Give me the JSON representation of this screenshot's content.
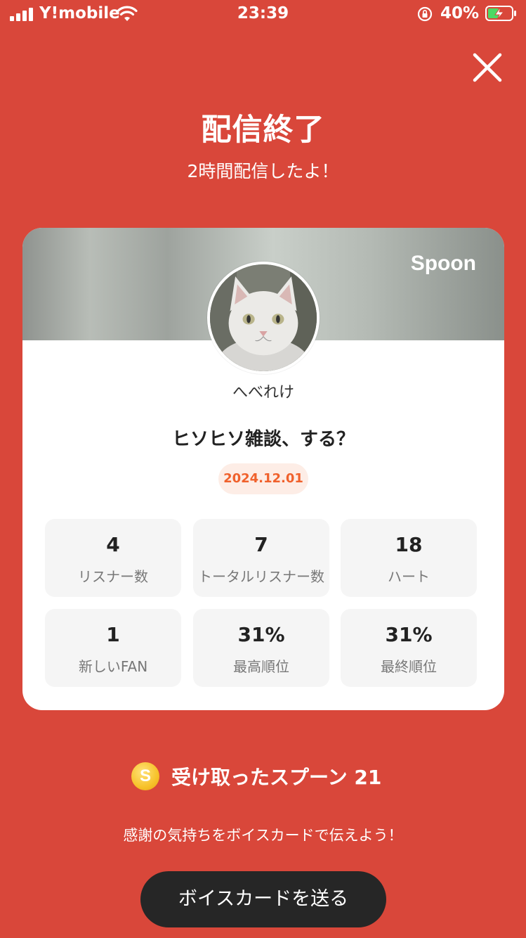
{
  "status_bar": {
    "carrier": "Y!mobile",
    "time": "23:39",
    "battery": "40%"
  },
  "header": {
    "title": "配信終了",
    "subtitle": "2時間配信したよ！"
  },
  "card": {
    "brand": "Spoon",
    "username": "へべれけ",
    "stream_title": "ヒソヒソ雑談、する？",
    "date": "2024.12.01",
    "stats": [
      {
        "value": "4",
        "label": "リスナー数"
      },
      {
        "value": "7",
        "label": "トータルリスナー数"
      },
      {
        "value": "18",
        "label": "ハート"
      },
      {
        "value": "1",
        "label": "新しいFAN"
      },
      {
        "value": "31%",
        "label": "最高順位"
      },
      {
        "value": "31%",
        "label": "最終順位"
      }
    ]
  },
  "spoon": {
    "coin_symbol": "S",
    "label": "受け取ったスプーン  21"
  },
  "thanks_text": "感謝の気持ちをボイスカードで伝えよう！",
  "voice_card_button": "ボイスカードを送る",
  "colors": {
    "background": "#D9473A",
    "accent": "#F0612C",
    "button": "#262626"
  }
}
